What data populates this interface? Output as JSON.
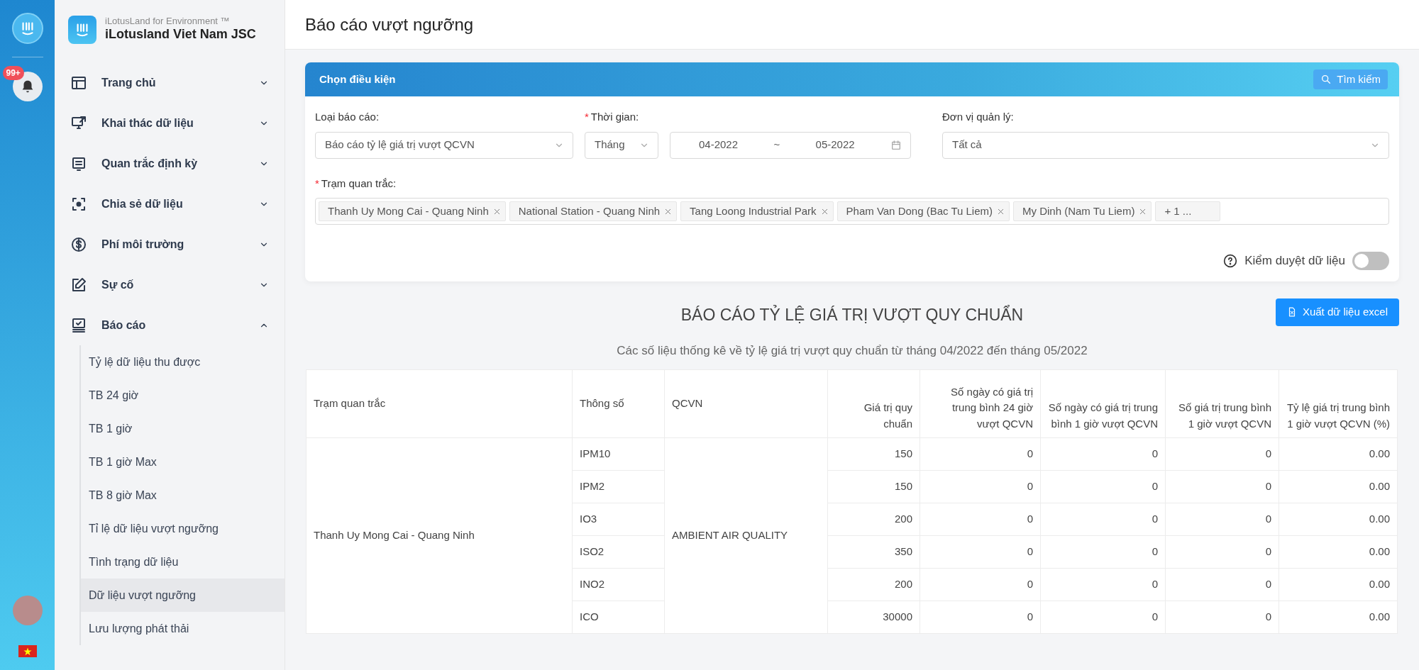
{
  "rail": {
    "notification_count": "99+"
  },
  "brand": {
    "subtitle": "iLotusLand for Environment ™",
    "title": "iLotusland Viet Nam JSC"
  },
  "sidebar": {
    "items": [
      {
        "label": "Trang chủ",
        "expanded": false
      },
      {
        "label": "Khai thác dữ liệu",
        "expanded": false
      },
      {
        "label": "Quan trắc định kỳ",
        "expanded": false
      },
      {
        "label": "Chia sẻ dữ liệu",
        "expanded": false
      },
      {
        "label": "Phí môi trường",
        "expanded": false
      },
      {
        "label": "Sự cố",
        "expanded": false
      },
      {
        "label": "Báo cáo",
        "expanded": true,
        "children": [
          {
            "label": "Tỷ lệ dữ liệu thu được",
            "selected": false
          },
          {
            "label": "TB 24 giờ",
            "selected": false
          },
          {
            "label": "TB 1 giờ",
            "selected": false
          },
          {
            "label": "TB 1 giờ Max",
            "selected": false
          },
          {
            "label": "TB 8 giờ Max",
            "selected": false
          },
          {
            "label": "Tỉ lệ dữ liệu vượt ngưỡng",
            "selected": false
          },
          {
            "label": "Tình trạng dữ liệu",
            "selected": false
          },
          {
            "label": "Dữ liệu vượt ngưỡng",
            "selected": true
          },
          {
            "label": "Lưu lượng phát thải",
            "selected": false
          }
        ]
      }
    ]
  },
  "page_title": "Báo cáo vượt ngưỡng",
  "filter_card": {
    "title": "Chọn điều kiện",
    "search_button": "Tìm kiếm",
    "report_type": {
      "label": "Loại báo cáo:",
      "value": "Báo cáo tỷ lệ giá trị vượt QCVN"
    },
    "time": {
      "required_mark": "*",
      "label": "Thời gian:",
      "period": "Tháng",
      "start": "04-2022",
      "separator": "~",
      "end": "05-2022"
    },
    "unit": {
      "label": "Đơn vị quản lý:",
      "value": "Tất cả"
    },
    "stations": {
      "required_mark": "*",
      "label": "Trạm quan trắc:",
      "tags": [
        "Thanh Uy Mong Cai - Quang Ninh",
        "National Station - Quang Ninh",
        "Tang Loong Industrial Park",
        "Pham Van Dong (Bac Tu Liem)",
        "My Dinh (Nam Tu Liem)"
      ],
      "more": "+ 1 ..."
    },
    "review_toggle": {
      "label": "Kiểm duyệt dữ liệu",
      "on": false
    }
  },
  "report": {
    "title": "BÁO CÁO TỶ LỆ GIÁ TRỊ VƯỢT QUY CHUẨN",
    "export_button": "Xuất dữ liệu excel",
    "subtitle": "Các số liệu thống kê về tỷ lệ giá trị vượt quy chuẩn từ tháng 04/2022 đến tháng 05/2022",
    "table": {
      "columns": [
        "Trạm quan trắc",
        "Thông số",
        "QCVN",
        "Giá trị quy chuẩn",
        "Số ngày có giá trị trung bình 24 giờ vượt QCVN",
        "Số ngày có giá trị trung bình 1 giờ vượt QCVN",
        "Số giá trị trung bình 1 giờ vượt QCVN",
        "Tỷ lệ giá trị trung bình 1 giờ vượt QCVN (%)"
      ],
      "groups": [
        {
          "station": "Thanh Uy Mong Cai - Quang Ninh",
          "qcvn": "AMBIENT AIR QUALITY",
          "rows": [
            {
              "parameter": "IPM10",
              "values": [
                "150",
                "0",
                "0",
                "0",
                "0.00"
              ]
            },
            {
              "parameter": "IPM2",
              "values": [
                "150",
                "0",
                "0",
                "0",
                "0.00"
              ]
            },
            {
              "parameter": "IO3",
              "values": [
                "200",
                "0",
                "0",
                "0",
                "0.00"
              ]
            },
            {
              "parameter": "ISO2",
              "values": [
                "350",
                "0",
                "0",
                "0",
                "0.00"
              ]
            },
            {
              "parameter": "INO2",
              "values": [
                "200",
                "0",
                "0",
                "0",
                "0.00"
              ]
            },
            {
              "parameter": "ICO",
              "values": [
                "30000",
                "0",
                "0",
                "0",
                "0.00"
              ]
            }
          ]
        }
      ]
    }
  }
}
